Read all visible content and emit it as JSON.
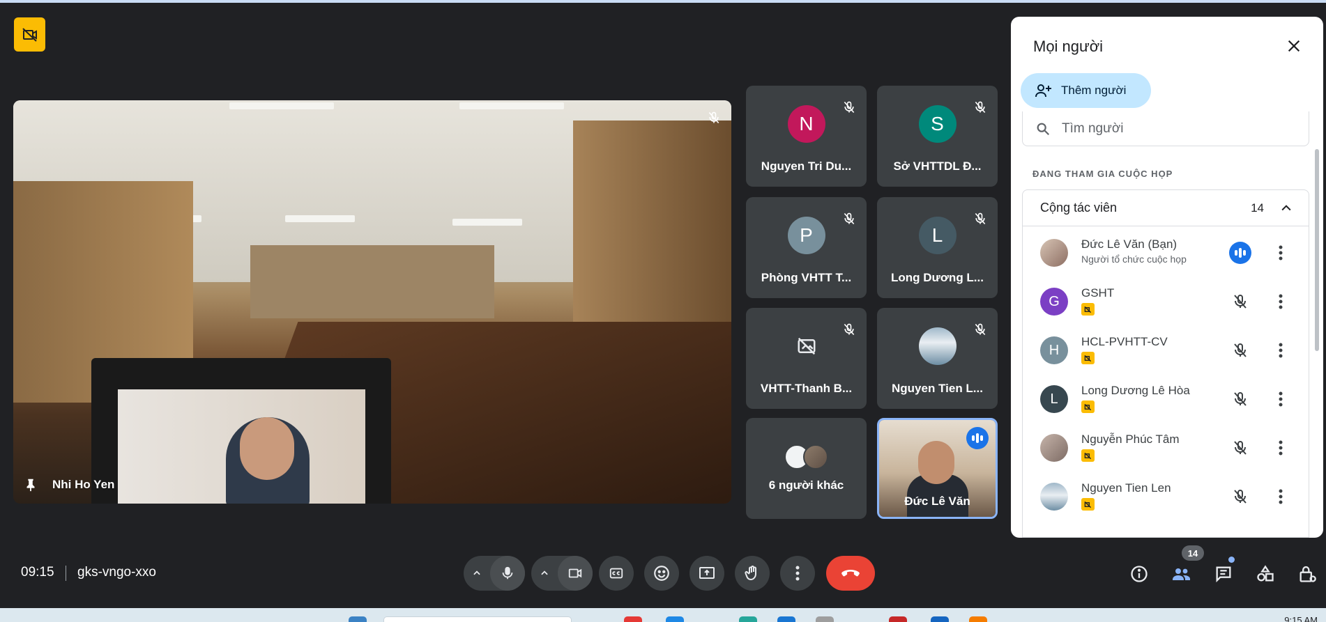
{
  "main_speaker": {
    "name": "Nhi Ho Yen"
  },
  "tiles": [
    {
      "initial": "N",
      "name": "Nguyen Tri Du...",
      "color": "#c2185b"
    },
    {
      "initial": "S",
      "name": "Sở VHTTDL Đ...",
      "color": "#00897b"
    },
    {
      "initial": "P",
      "name": "Phòng VHTT T...",
      "color": "#78909c"
    },
    {
      "initial": "L",
      "name": "Long Dương L...",
      "color": "#455a64"
    },
    {
      "initial": "",
      "name": "VHTT-Thanh B...",
      "color": ""
    },
    {
      "initial": "",
      "name": "Nguyen Tien L...",
      "color": ""
    },
    {
      "initial": "",
      "name": "6 người khác",
      "color": ""
    },
    {
      "initial": "",
      "name": "Đức Lê Văn",
      "color": ""
    }
  ],
  "panel": {
    "title": "Mọi người",
    "add_button": "Thêm người",
    "search_placeholder": "Tìm người",
    "section_label": "ĐANG THAM GIA CUỘC HỌP",
    "group": {
      "label": "Cộng tác viên",
      "count": "14"
    },
    "people": [
      {
        "name": "Đức Lê Văn (Bạn)",
        "subtitle": "Người tổ chức cuộc họp",
        "initial": "",
        "color": "#8d6e63",
        "speaking": true
      },
      {
        "name": "GSHT",
        "subtitle": "",
        "initial": "G",
        "color": "#7b3fc4",
        "speaking": false
      },
      {
        "name": "HCL-PVHTT-CV",
        "subtitle": "",
        "initial": "H",
        "color": "#78909c",
        "speaking": false
      },
      {
        "name": "Long Dương Lê Hòa",
        "subtitle": "",
        "initial": "L",
        "color": "#37474f",
        "speaking": false
      },
      {
        "name": "Nguyễn Phúc Tâm",
        "subtitle": "",
        "initial": "",
        "color": "#9e8d86",
        "speaking": false
      },
      {
        "name": "Nguyen Tien Len",
        "subtitle": "",
        "initial": "",
        "color": "#6d8ea4",
        "speaking": false
      }
    ]
  },
  "bottom_bar": {
    "time": "09:15",
    "meeting_code": "gks-vngo-xxo",
    "people_count": "14"
  },
  "taskbar": {
    "time": "9:15 AM"
  },
  "colors": {
    "background": "#202124",
    "tile": "#3c4043",
    "accent": "#1a73e8",
    "end_call": "#ea4335",
    "record_badge": "#fbbc04"
  }
}
